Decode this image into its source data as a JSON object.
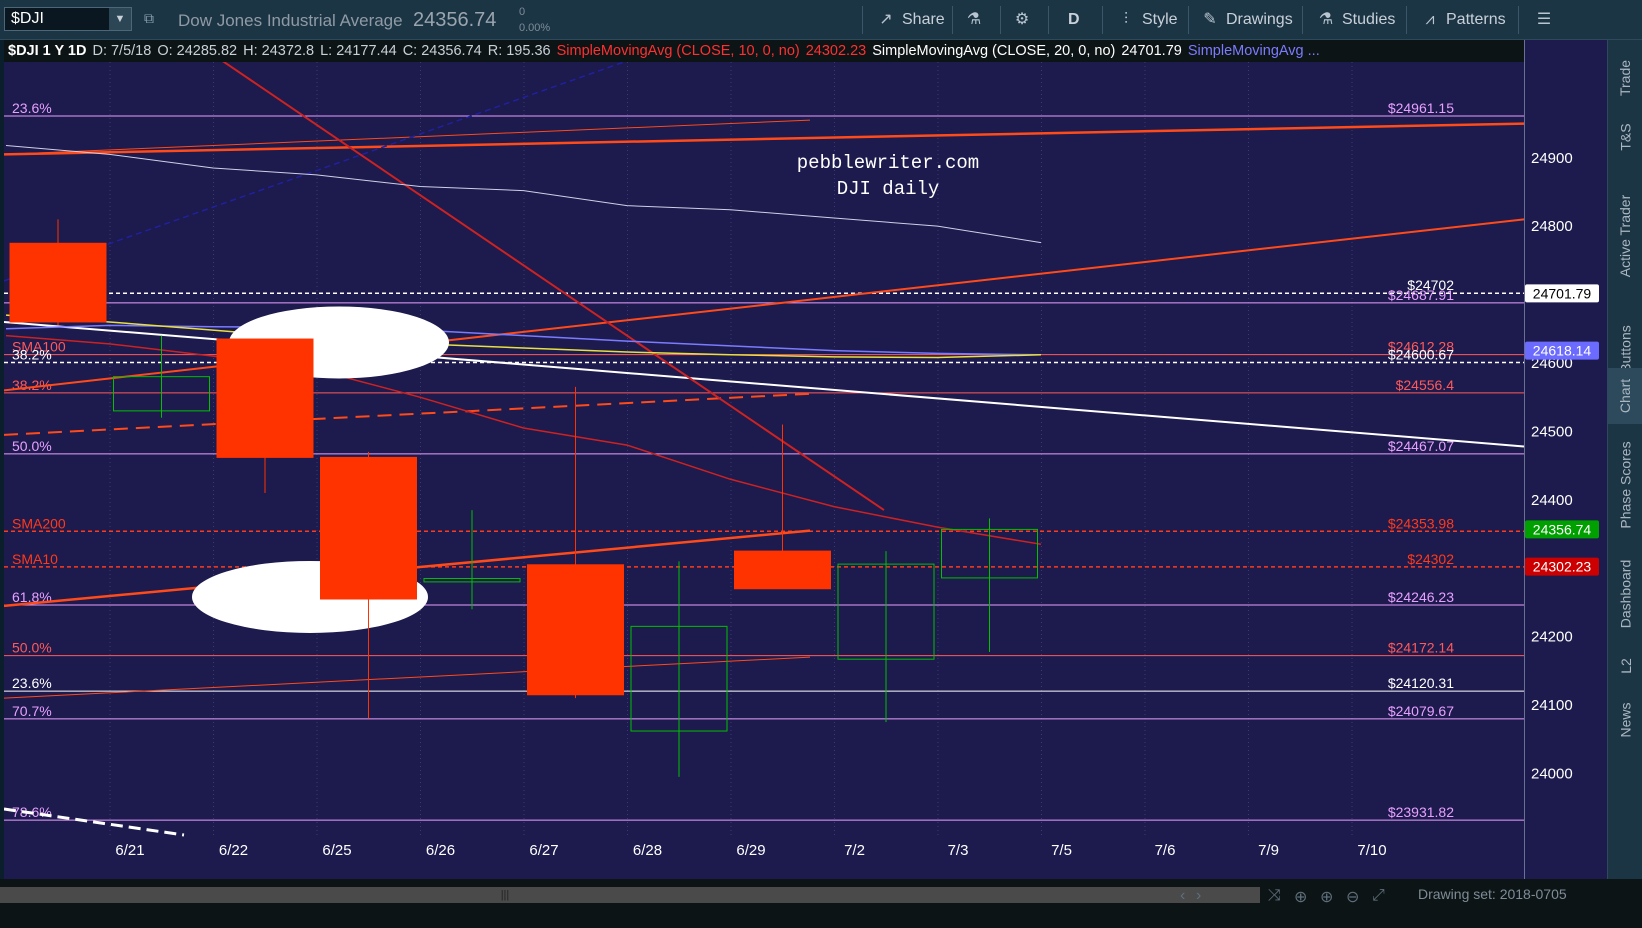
{
  "toolbar": {
    "symbol": "$DJI",
    "description": "Dow Jones Industrial Average",
    "last": "24356.74",
    "change": "0",
    "change_pct": "0.00%",
    "share": "Share",
    "period": "D",
    "style": "Style",
    "drawings": "Drawings",
    "studies": "Studies",
    "patterns": "Patterns"
  },
  "studybar": {
    "symbol_period": "$DJI 1 Y 1D",
    "date": "D: 7/5/18",
    "open": "O: 24285.82",
    "high": "H: 24372.8",
    "low": "L: 24177.44",
    "close": "C: 24356.74",
    "range": "R: 195.36",
    "sma10_label": "SimpleMovingAvg (CLOSE, 10, 0, no)",
    "sma10_value": "24302.23",
    "sma20_label": "SimpleMovingAvg (CLOSE, 20, 0, no)",
    "sma20_value": "24701.79",
    "sma3_label": "SimpleMovingAvg ..."
  },
  "watermark": {
    "line1": "pebblewriter.com",
    "line2": "DJI daily"
  },
  "chart_data": {
    "type": "candlestick",
    "dates": [
      "6/21",
      "6/22",
      "6/25",
      "6/26",
      "6/27",
      "6/28",
      "6/29",
      "7/2",
      "7/3",
      "7/5"
    ],
    "candles": [
      {
        "date": "6/21",
        "open": 24775,
        "high": 24810,
        "low": 24655,
        "close": 24660
      },
      {
        "date": "6/22",
        "open": 24530,
        "high": 24640,
        "low": 24520,
        "close": 24580
      },
      {
        "date": "6/25",
        "open": 24635,
        "high": 24470,
        "low": 24410,
        "close": 24462
      },
      {
        "date": "6/26",
        "open": 24462,
        "high": 24470,
        "low": 24080,
        "close": 24255
      },
      {
        "date": "6/27",
        "open": 24280,
        "high": 24385,
        "low": 24240,
        "close": 24285
      },
      {
        "date": "6/28",
        "open": 24305,
        "high": 24565,
        "low": 24110,
        "close": 24115
      },
      {
        "date": "6/29",
        "open": 24062,
        "high": 24310,
        "low": 23995,
        "close": 24215
      },
      {
        "date": "7/2",
        "open": 24325,
        "high": 24510,
        "low": 24270,
        "close": 24270
      },
      {
        "date": "7/3",
        "open": 24167,
        "high": 24325,
        "low": 24075,
        "close": 24306
      },
      {
        "date": "7/5",
        "open": 24285.82,
        "high": 24372.8,
        "low": 24177.44,
        "close": 24356.74
      }
    ],
    "ylim": [
      23910,
      25040
    ],
    "yticks": [
      24000,
      24100,
      24200,
      24300,
      24400,
      24500,
      24600,
      24700,
      24800,
      24900
    ],
    "xticks": [
      "6/21",
      "6/22",
      "6/25",
      "6/26",
      "6/27",
      "6/28",
      "6/29",
      "7/2",
      "7/3",
      "7/5",
      "7/6",
      "7/9",
      "7/10"
    ],
    "sma": [
      {
        "name": "SMA20",
        "values": [
          24918,
          24905,
          24885,
          24875,
          24858,
          24852,
          24830,
          24824,
          24812,
          24800,
          24776,
          24745,
          24705
        ]
      },
      {
        "name": "SMA10",
        "values": [
          24640,
          24628,
          24610,
          24590,
          24550,
          24505,
          24480,
          24430,
          24390,
          24360,
          24335,
          24315,
          24302
        ]
      },
      {
        "name": "SMA200",
        "values": [
          24355,
          24355,
          24354,
          24354,
          24354,
          24354,
          24354,
          24354,
          24354,
          24354,
          24354,
          24354,
          24354
        ]
      },
      {
        "name": "SMA100",
        "values": [
          24650,
          24655,
          24653,
          24652,
          24648,
          24640,
          24632,
          24625,
          24618,
          24614,
          24612,
          24615,
          24618
        ]
      },
      {
        "name": "SMA50",
        "values": [
          24670,
          24660,
          24648,
          24636,
          24628,
          24622,
          24616,
          24612,
          24609,
          24608,
          24612,
          24615,
          24618
        ]
      }
    ],
    "levels": [
      {
        "price": 24961.15,
        "label": "23.6%",
        "value_label": "$24961.15",
        "color": "#e8a0ff"
      },
      {
        "price": 24702,
        "label": "",
        "value_label": "$24702",
        "color": "#ffffff",
        "dashed": true
      },
      {
        "price": 24687.91,
        "label": "38.2%",
        "value_label": "$24687.91",
        "color": "#e8a0ff"
      },
      {
        "price": 24612.28,
        "label": "SMA100",
        "value_label": "$24612.28",
        "color": "#ff5a5a"
      },
      {
        "price": 24600.67,
        "label": "38.2%",
        "value_label": "$24600.67",
        "color": "#ffffff",
        "dashed": true
      },
      {
        "price": 24556.4,
        "label": "38.2%",
        "value_label": "$24556.4",
        "color": "#ff5a5a"
      },
      {
        "price": 24467.07,
        "label": "50.0%",
        "value_label": "$24467.07",
        "color": "#e8a0ff"
      },
      {
        "price": 24353.98,
        "label": "SMA200",
        "value_label": "$24353.98",
        "color": "#ff3a1a",
        "dashed": true
      },
      {
        "price": 24302,
        "label": "SMA10",
        "value_label": "$24302",
        "color": "#ff3a1a",
        "dashed": true
      },
      {
        "price": 24246.23,
        "label": "61.8%",
        "value_label": "$24246.23",
        "color": "#e8a0ff"
      },
      {
        "price": 24172.14,
        "label": "50.0%",
        "value_label": "$24172.14",
        "color": "#ff5a5a"
      },
      {
        "price": 24120.31,
        "label": "23.6%",
        "value_label": "$24120.31",
        "color": "#ffffff"
      },
      {
        "price": 24079.67,
        "label": "70.7%",
        "value_label": "$24079.67",
        "color": "#e8a0ff"
      },
      {
        "price": 23931.82,
        "label": "78.6%",
        "value_label": "$23931.82",
        "color": "#e8a0ff"
      }
    ],
    "price_tags": [
      {
        "price": 24701.79,
        "label": "24701.79",
        "bg": "#ffffff",
        "fg": "#000000"
      },
      {
        "price": 24618.14,
        "label": "24618.14",
        "bg": "#6b6bff",
        "fg": "#ffffff"
      },
      {
        "price": 24356.74,
        "label": "24356.74",
        "bg": "#00a000",
        "fg": "#ffffff"
      },
      {
        "price": 24302.23,
        "label": "24302.23",
        "bg": "#cc0000",
        "fg": "#ffffff"
      }
    ],
    "colors": {
      "up": "#00c000",
      "down": "#ff3300",
      "background": "#1d1a4d"
    }
  },
  "sidebar": [
    "Trade",
    "T&S",
    "Active Trader",
    "Buttons",
    "Chart",
    "Phase Scores",
    "Dashboard",
    "L2",
    "News"
  ],
  "footer": {
    "drawing_set": "Drawing set: 2018-0705"
  }
}
